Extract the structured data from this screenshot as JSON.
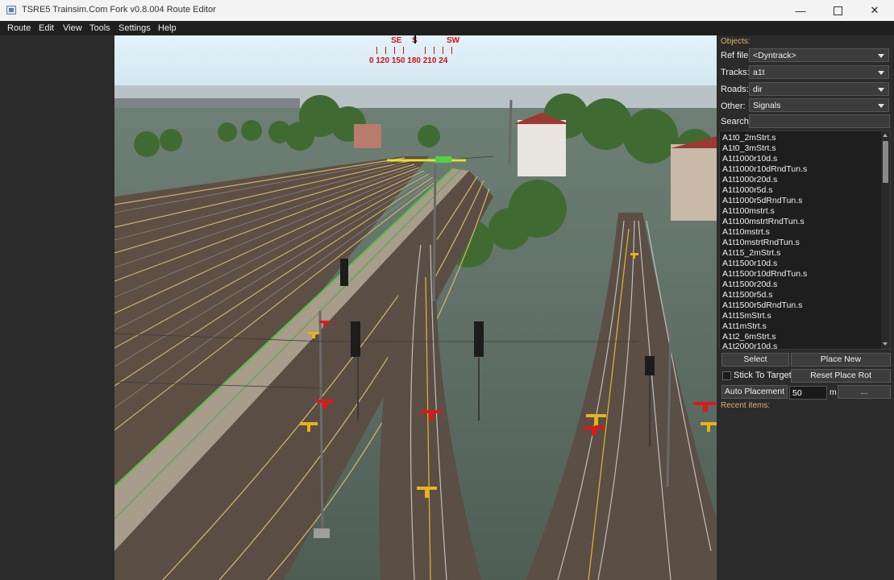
{
  "window": {
    "title": "TSRE5 Trainsim.Com Fork v0.8.004 Route Editor"
  },
  "menu": [
    "Route",
    "Edit",
    "View",
    "Tools",
    "Settings",
    "Help"
  ],
  "compass": {
    "directions": [
      "SE",
      "S",
      "SW"
    ],
    "degrees": "0 120 150 180 210 24"
  },
  "panel": {
    "objects_label": "Objects:",
    "ref_file": {
      "label": "Ref file:",
      "value": "<Dyntrack>"
    },
    "tracks": {
      "label": "Tracks:",
      "value": "a1t"
    },
    "roads": {
      "label": "Roads:",
      "value": "dir"
    },
    "other": {
      "label": "Other:",
      "value": "Signals"
    },
    "search": {
      "label": "Search:",
      "value": ""
    },
    "items": [
      "A1t0_2mStrt.s",
      "A1t0_3mStrt.s",
      "A1t1000r10d.s",
      "A1t1000r10dRndTun.s",
      "A1t1000r20d.s",
      "A1t1000r5d.s",
      "A1t1000r5dRndTun.s",
      "A1t100mstrt.s",
      "A1t100mstrtRndTun.s",
      "A1t10mstrt.s",
      "A1t10mstrtRndTun.s",
      "A1t15_2mStrt.s",
      "A1t1500r10d.s",
      "A1t1500r10dRndTun.s",
      "A1t1500r20d.s",
      "A1t1500r5d.s",
      "A1t1500r5dRndTun.s",
      "A1t15mStrt.s",
      "A1t1mStrt.s",
      "A1t2_6mStrt.s",
      "A1t2000r10d.s"
    ],
    "select_button": "Select",
    "place_new_button": "Place New",
    "stick_to_target_label": "Stick To Target",
    "stick_to_target_checked": false,
    "reset_place_rot_button": "Reset Place Rot",
    "auto_placement_button": "Auto Placement",
    "auto_placement_value": "50",
    "auto_placement_unit": "m",
    "more_button": "...",
    "recent_label": "Recent items:"
  }
}
